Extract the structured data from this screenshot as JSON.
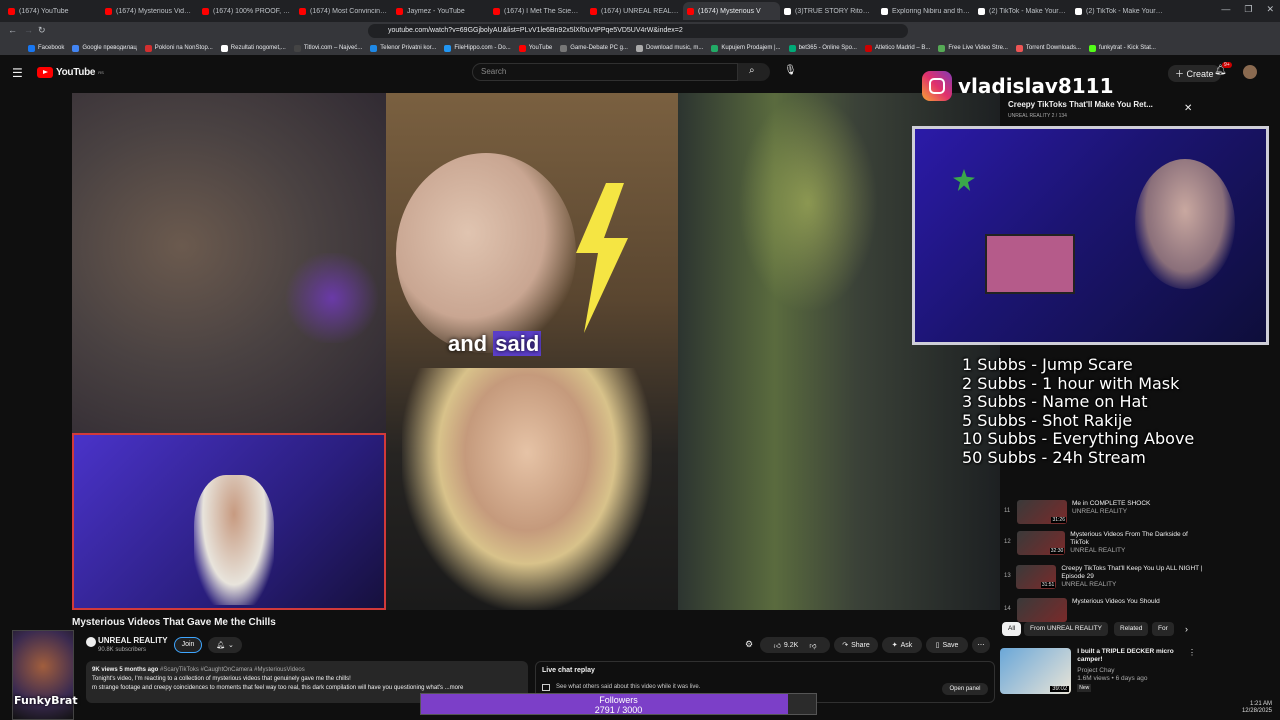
{
  "browser": {
    "tabs": [
      {
        "title": "(1674) YouTube",
        "color": "#ff0000"
      },
      {
        "title": "(1674) Mysterious Videos N",
        "color": "#ff0000"
      },
      {
        "title": "(1674) 100% PROOF, PARA",
        "color": "#ff0000"
      },
      {
        "title": "(1674) Most Convincing Evi",
        "color": "#ff0000"
      },
      {
        "title": "Jaymez - YouTube",
        "color": "#ff0000"
      },
      {
        "title": "(1674) I Met The Scientist T",
        "color": "#ff0000"
      },
      {
        "title": "(1674) UNREAL REALITY - Y",
        "color": "#ff0000"
      },
      {
        "title": "(1674) Mysterious V",
        "color": "#ff0000",
        "active": true
      },
      {
        "title": "(3)TRUE STORY Ritoseo",
        "color": "#ffffff"
      },
      {
        "title": "Exploring Nibiru and the N",
        "color": "#ffffff"
      },
      {
        "title": "(2) TikTok - Make Your Day",
        "color": "#ffffff"
      },
      {
        "title": "(2) TikTok - Make Your Day",
        "color": "#ffffff"
      }
    ],
    "url": "youtube.com/watch?v=69GGjbolyAU&list=PLvV1le6Bn92x5lXf0uVtPPqe5VD5UV4rW&index=2",
    "bookmarks": [
      "Facebook",
      "Google преводилац",
      "Pokloni na NonStop...",
      "Rezultati nogomet,...",
      "Titlovi.com – Najveć...",
      "Telenor Privatni kor...",
      "FileHippo.com - Do...",
      "YouTube",
      "Game-Debate PC g...",
      "Download music, m...",
      "Kupujem Prodajem |...",
      "bet365 - Online Spo...",
      "Atletico Madrid – B...",
      "Free Live Video Stre...",
      "Torrent Downloads...",
      "funkytrat - Kick Stat..."
    ]
  },
  "youtube": {
    "logo": "YouTube",
    "logo_country": "RS",
    "search_placeholder": "Search",
    "create_label": "Create",
    "notif_count": "9+"
  },
  "video": {
    "caption_pre": "and",
    "caption_hl": "said",
    "title": "Mysterious Videos That Gave Me the Chills",
    "channel": "UNREAL REALITY",
    "subscribers": "90.8K subscribers",
    "join_label": "Join",
    "likes": "9.2K",
    "share_label": "Share",
    "ask_label": "Ask",
    "save_label": "Save",
    "desc_meta": "9K views  5 months ago",
    "desc_tags": " #ScaryTikToks #CaughtOnCamera #MysteriousVideos",
    "desc_line2": "Tonight's video, I'm reacting to a collection of mysterious videos that genuinely gave me the chills!",
    "desc_line3": "m strange footage and creepy coincidences to moments that feel way too real, this dark compilation will have you questioning what's ...more",
    "chat_title": "Live chat replay",
    "chat_sub": "See what others said about this video while it was live.",
    "open_panel": "Open panel"
  },
  "overlay": {
    "instagram_handle": "vladislav8111",
    "sub_goals": [
      "1 Subbs - Jump Scare",
      "2 Subbs - 1 hour with Mask",
      "3 Subbs - Name on Hat",
      "5 Subbs - Shot Rakije",
      "10 Subbs - Everything Above",
      "50 Subbs - 24h Stream"
    ],
    "followers_label": "Followers",
    "followers_value": "2791 / 3000",
    "followers_progress": 0.93,
    "streamer_name": "FunkyBrat"
  },
  "playlist": {
    "title": "Creepy TikToks That'll Make You Ret...",
    "meta": "UNREAL REALITY  2 / 134",
    "items": [
      {
        "num": "11",
        "title": "Me in COMPLETE SHOCK",
        "channel": "UNREAL REALITY",
        "dur": "31:26"
      },
      {
        "num": "12",
        "title": "Mysterious Videos From The Darkside of TikTok",
        "channel": "UNREAL REALITY",
        "dur": "32:30"
      },
      {
        "num": "13",
        "title": "Creepy TikToks That'll Keep You Up ALL NIGHT | Episode 29",
        "channel": "UNREAL REALITY",
        "dur": "31:51"
      },
      {
        "num": "14",
        "title": "Mysterious Videos You Should",
        "channel": "",
        "dur": ""
      }
    ]
  },
  "chips": [
    "All",
    "From UNREAL REALITY",
    "Related",
    "For"
  ],
  "recommendation": {
    "title": "I built a TRIPLE DECKER micro camper!",
    "channel": "Project Chay",
    "meta": "1.6M views • 6 days ago",
    "badge": "New",
    "dur": "39:02"
  },
  "taskbar": {
    "time": "1:21 AM",
    "date": "12/28/2025"
  }
}
